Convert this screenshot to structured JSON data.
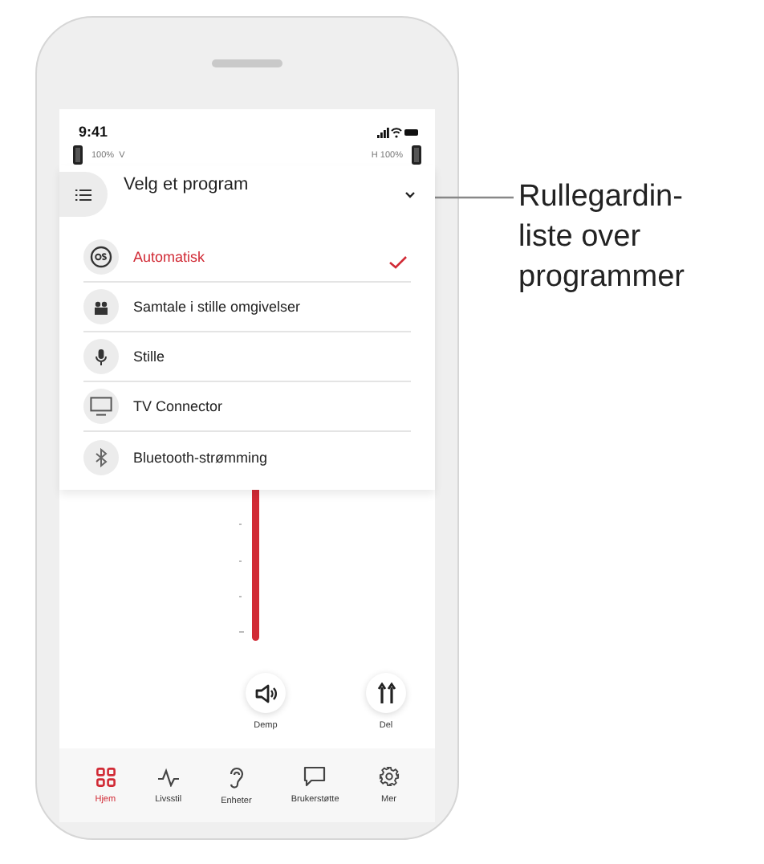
{
  "status_bar": {
    "time": "9:41"
  },
  "hearing_aids": [
    {
      "kind": "left",
      "text": "100%  V"
    },
    {
      "kind": "right",
      "text": "H 100%"
    }
  ],
  "program_menu": {
    "title": "Velg et program",
    "expanded": true,
    "items": [
      {
        "label": "Automatisk",
        "kind": "automatic",
        "selected": true
      },
      {
        "label": "Samtale i stille omgivelser",
        "kind": "conversation",
        "selected": false
      },
      {
        "label": "Stille",
        "kind": "quiet",
        "selected": false
      },
      {
        "label": "TV Connector",
        "kind": "tv",
        "selected": false
      },
      {
        "label": "Bluetooth-strømming",
        "kind": "bluetooth",
        "selected": false
      }
    ]
  },
  "actions": [
    {
      "label": "Demp",
      "kind": "mute"
    },
    {
      "label": "Del",
      "kind": "split"
    }
  ],
  "nav": [
    {
      "label": "Hjem",
      "kind": "home",
      "selected": true
    },
    {
      "label": "Livsstil",
      "kind": "lifestyle",
      "selected": false
    },
    {
      "label": "Enheter",
      "kind": "devices",
      "selected": false
    },
    {
      "label": "Brukerstøtte",
      "kind": "support",
      "selected": false
    },
    {
      "label": "Mer",
      "kind": "more",
      "selected": false
    }
  ],
  "callout": {
    "text": "Rullegardin-liste over programmer"
  }
}
